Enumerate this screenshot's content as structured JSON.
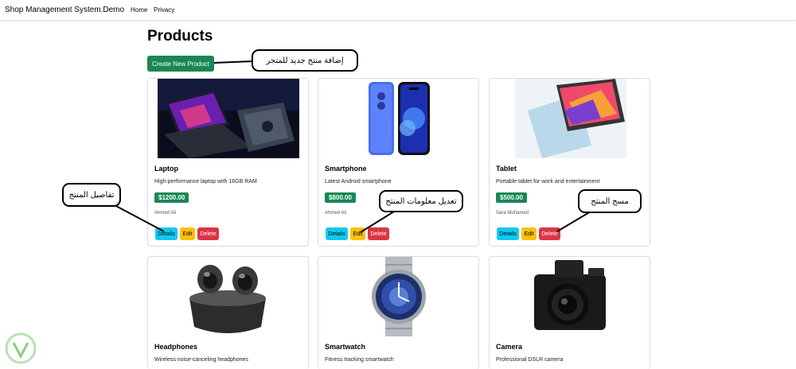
{
  "navbar": {
    "brand": "Shop Management System.Demo",
    "links": [
      "Home",
      "Privacy"
    ]
  },
  "page": {
    "title": "Products",
    "create_button": "Create New Product"
  },
  "products": [
    {
      "name": "Laptop",
      "description": "High-performance laptop with 16GB RAM",
      "price": "$1200.00",
      "owner": "Ahmed Ali",
      "image_icon": "laptop-photo"
    },
    {
      "name": "Smartphone",
      "description": "Latest Android smartphone",
      "price": "$800.00",
      "owner": "Ahmed Ali",
      "image_icon": "smartphone-photo"
    },
    {
      "name": "Tablet",
      "description": "Portable tablet for work and entertainment",
      "price": "$500.00",
      "owner": "Sara Mohamed",
      "image_icon": "tablet-photo"
    },
    {
      "name": "Headphones",
      "description": "Wireless noise-canceling headphones",
      "image_icon": "earbuds-photo"
    },
    {
      "name": "Smartwatch",
      "description": "Fitness tracking smartwatch",
      "image_icon": "smartwatch-photo"
    },
    {
      "name": "Camera",
      "description": "Professional DSLR camera",
      "image_icon": "camera-photo"
    }
  ],
  "actions": {
    "details": "Details",
    "edit": "Edit",
    "delete": "Delete"
  },
  "callouts": {
    "add_product": "إضافة منتج جديد للمتجر",
    "details": "تفاصيل المنتج",
    "edit": "تعديل معلومات المنتج",
    "delete": "مسح المنتج"
  },
  "colors": {
    "success": "#198754",
    "info": "#0dcaf0",
    "warning": "#ffc107",
    "danger": "#dc3545"
  }
}
